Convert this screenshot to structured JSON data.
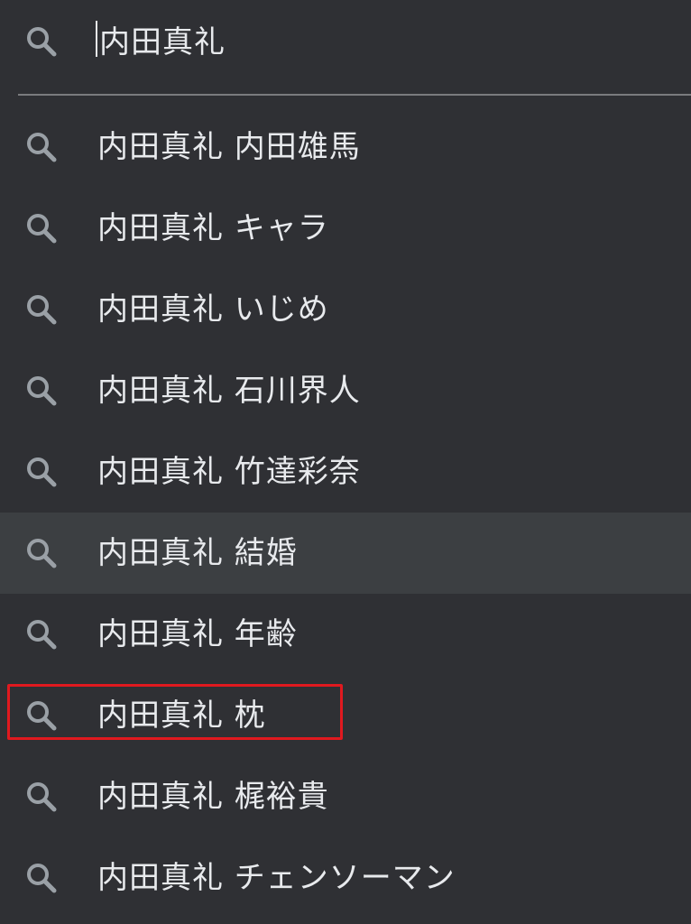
{
  "search": {
    "query": "内田真礼",
    "icon": "search-icon"
  },
  "suggestions": [
    {
      "text": "内田真礼 内田雄馬",
      "icon": "search-icon"
    },
    {
      "text": "内田真礼 キャラ",
      "icon": "search-icon"
    },
    {
      "text": "内田真礼 いじめ",
      "icon": "search-icon"
    },
    {
      "text": "内田真礼 石川界人",
      "icon": "search-icon"
    },
    {
      "text": "内田真礼 竹達彩奈",
      "icon": "search-icon"
    },
    {
      "text": "内田真礼 結婚",
      "icon": "search-icon",
      "hovered": true
    },
    {
      "text": "内田真礼 年齢",
      "icon": "search-icon"
    },
    {
      "text": "内田真礼 枕",
      "icon": "search-icon",
      "annotated": true
    },
    {
      "text": "内田真礼 梶裕貴",
      "icon": "search-icon"
    },
    {
      "text": "内田真礼 チェンソーマン",
      "icon": "search-icon"
    }
  ],
  "colors": {
    "background": "#2f3034",
    "hover_row": "#3c3f42",
    "text": "#e8eaed",
    "icon": "#9aa0a6",
    "annotation_box": "#e0191f"
  }
}
